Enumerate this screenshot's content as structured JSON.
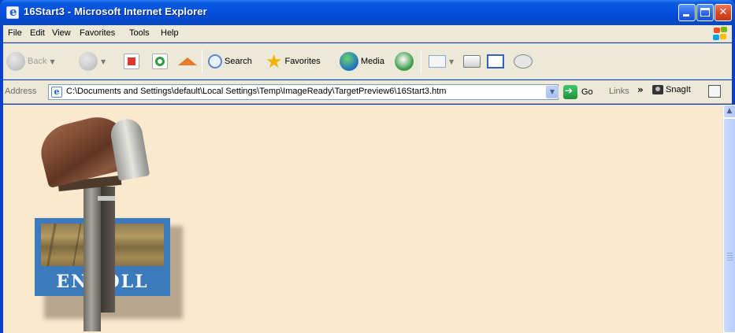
{
  "window": {
    "title": "16Start3 - Microsoft Internet Explorer",
    "title_bar_color": "#0550dc"
  },
  "menu": {
    "items": [
      "File",
      "Edit",
      "View",
      "Favorites",
      "Tools",
      "Help"
    ]
  },
  "toolbar": {
    "back_label": "Back",
    "search_label": "Search",
    "favorites_label": "Favorites",
    "media_label": "Media"
  },
  "address": {
    "label": "Address",
    "value": "C:\\Documents and Settings\\default\\Local Settings\\Temp\\ImageReady\\TargetPreview6\\16Start3.htm",
    "go_label": "Go",
    "links_label": "Links",
    "snagit_label": "SnagIt"
  },
  "content": {
    "background": "#fbe8cf",
    "enroll_label": "ENROLL",
    "enroll_box_color": "#3b7bbd"
  }
}
